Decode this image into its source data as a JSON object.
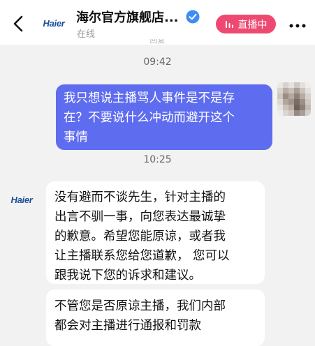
{
  "header": {
    "brand_logo_text": "Haier",
    "shop_name": "海尔官方旗舰店...",
    "status": "在线",
    "live_label": "直播中",
    "live_color": "#ee4a71",
    "icons": [
      "back-arrow-icon",
      "verified-badge-icon",
      "live-bars-icon",
      "more-dots-icon"
    ]
  },
  "chat": {
    "partial_text": "回复",
    "timestamps": [
      "09:42",
      "10:25"
    ],
    "user_message": {
      "lines": [
        "我只想说主播骂人事件是不是存",
        "在？不要说什么冲动而避开这个",
        "事情"
      ],
      "bubble_color": "#5e6cf0"
    },
    "shop_avatar_text": "Haier",
    "shop_messages": [
      {
        "lines": [
          "没有避而不谈先生，针对主播的",
          "出言不驯一事，向您表达最诚挚",
          "的歉意。希望您能原谅，或者我",
          "让主播联系您给您道歉， 您可以",
          "跟我说下您的诉求和建议。"
        ]
      },
      {
        "lines": [
          "不管您是否原谅主播，我们内部",
          "都会对主播进行通报和罚款"
        ]
      }
    ]
  }
}
